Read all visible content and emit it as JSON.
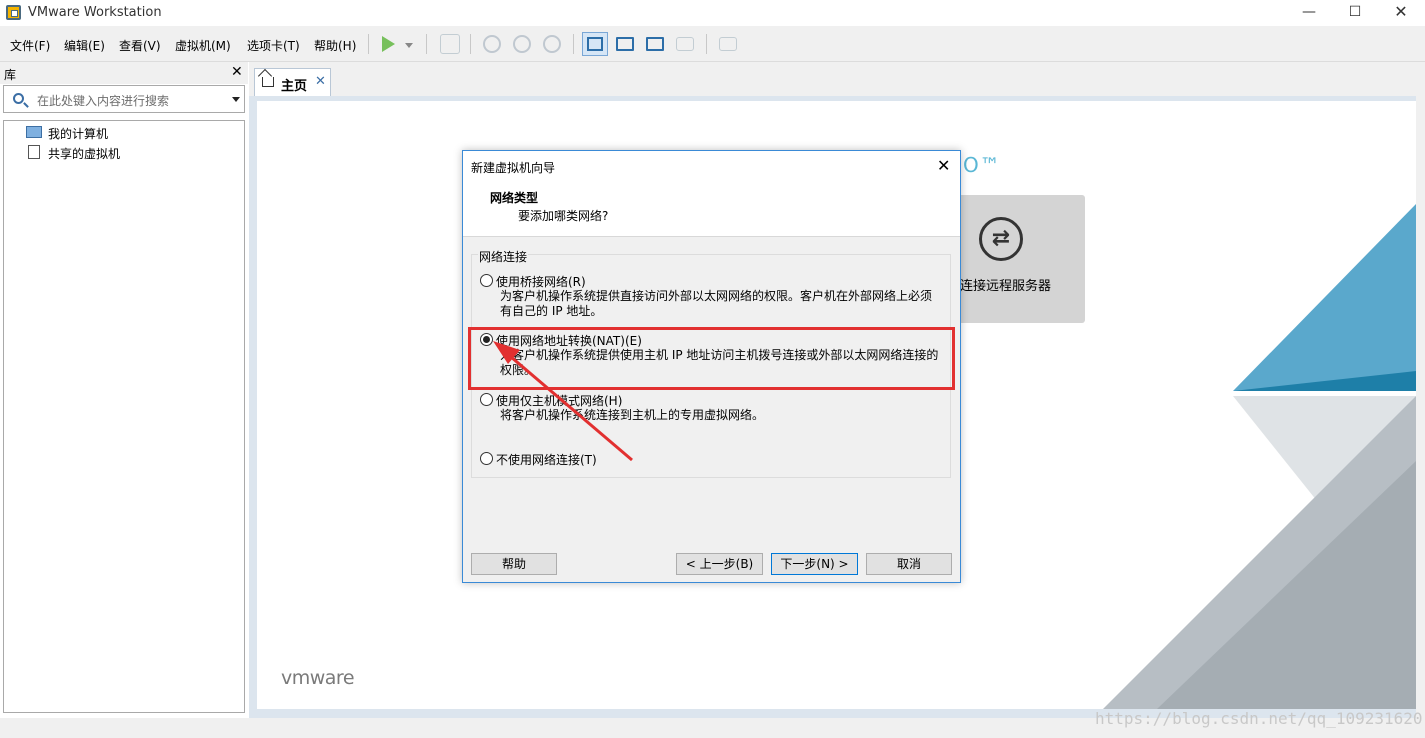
{
  "window": {
    "title": "VMware Workstation",
    "minimize_glyph": "—",
    "maximize_glyph": "☐",
    "close_glyph": "✕"
  },
  "menu": {
    "file": "文件(F)",
    "edit": "编辑(E)",
    "view": "查看(V)",
    "vm": "虚拟机(M)",
    "tabs": "选项卡(T)",
    "help": "帮助(H)"
  },
  "library": {
    "title": "库",
    "close_glyph": "✕",
    "search_placeholder": "在此处键入内容进行搜索",
    "items": [
      {
        "label": "我的计算机",
        "icon": "computer-icon"
      },
      {
        "label": "共享的虚拟机",
        "icon": "shared-vm-icon"
      }
    ]
  },
  "tab": {
    "label": "主页",
    "close_glyph": "✕"
  },
  "home": {
    "trademark": "O™",
    "remote_label": "连接远程服务器",
    "logo": "vmware"
  },
  "dialog": {
    "title": "新建虚拟机向导",
    "close_glyph": "✕",
    "heading": "网络类型",
    "subheading": "要添加哪类网络?",
    "group_label": "网络连接",
    "options": [
      {
        "label": "使用桥接网络(R)",
        "desc": "为客户机操作系统提供直接访问外部以太网网络的权限。客户机在外部网络上必须有自己的 IP 地址。",
        "checked": false
      },
      {
        "label": "使用网络地址转换(NAT)(E)",
        "desc": "为客户机操作系统提供使用主机 IP 地址访问主机拨号连接或外部以太网网络连接的权限。",
        "checked": true
      },
      {
        "label": "使用仅主机模式网络(H)",
        "desc": "将客户机操作系统连接到主机上的专用虚拟网络。",
        "checked": false
      },
      {
        "label": "不使用网络连接(T)",
        "desc": "",
        "checked": false
      }
    ],
    "buttons": {
      "help": "帮助",
      "back": "< 上一步(B)",
      "next": "下一步(N) >",
      "cancel": "取消"
    }
  },
  "watermark": "https://blog.csdn.net/qq_109231620",
  "colors": {
    "highlight": "#e23030",
    "dialog_border": "#3a8ad6",
    "accent_teal": "#5ab7d5"
  }
}
